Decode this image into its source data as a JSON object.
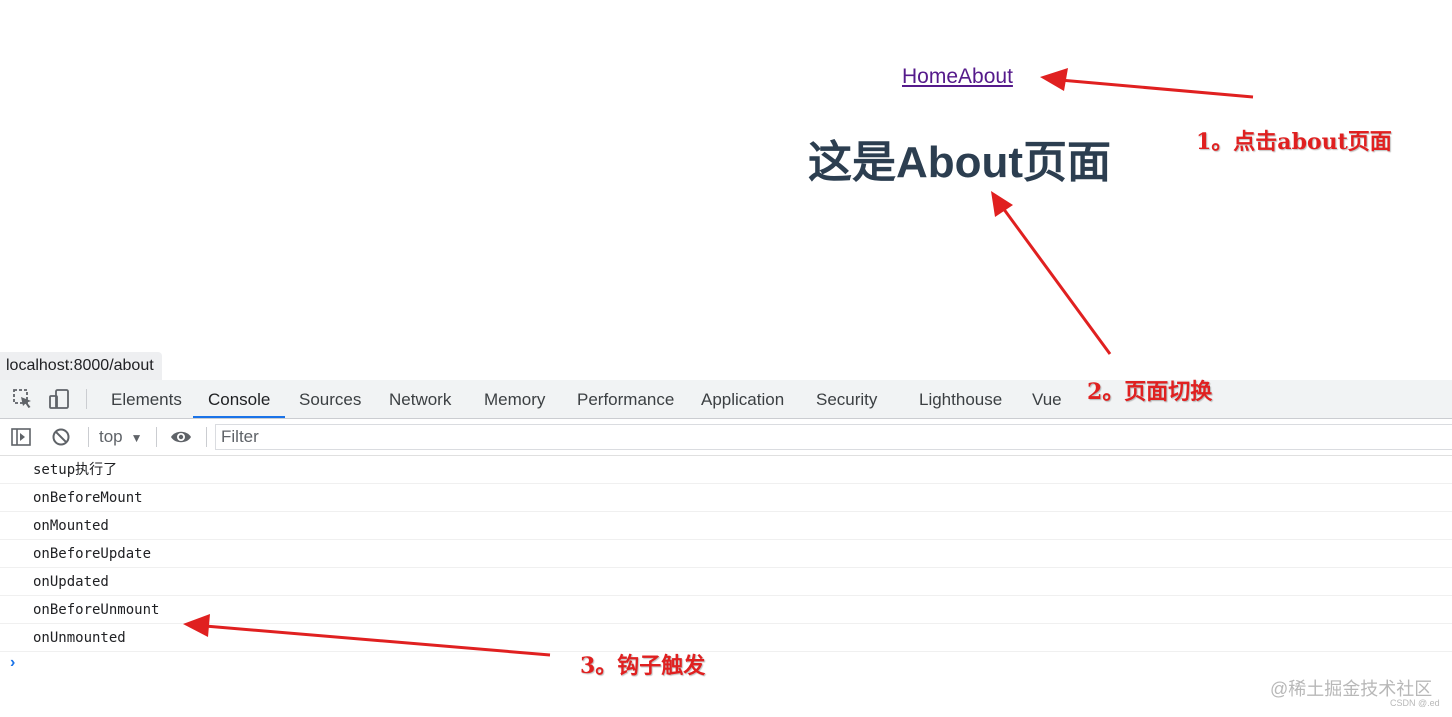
{
  "page": {
    "nav_links": [
      "Home",
      "About"
    ],
    "title": "这是About页面",
    "status_url": "localhost:8000/about"
  },
  "devtools": {
    "tabs": [
      "Elements",
      "Console",
      "Sources",
      "Network",
      "Memory",
      "Performance",
      "Application",
      "Security",
      "Lighthouse",
      "Vue"
    ],
    "active_tab": "Console",
    "context": "top",
    "filter_placeholder": "Filter",
    "console_lines": [
      "setup执行了",
      "onBeforeMount",
      "onMounted",
      "onBeforeUpdate",
      "onUpdated",
      "onBeforeUnmount",
      "onUnmounted"
    ],
    "prompt": "›"
  },
  "annotations": {
    "a1": "1。点击about页面",
    "a2": "2。页面切换",
    "a3": "3。钩子触发",
    "color": "#e02020"
  },
  "watermark": {
    "main": "@稀土掘金技术社区",
    "small": "CSDN @.ed"
  }
}
